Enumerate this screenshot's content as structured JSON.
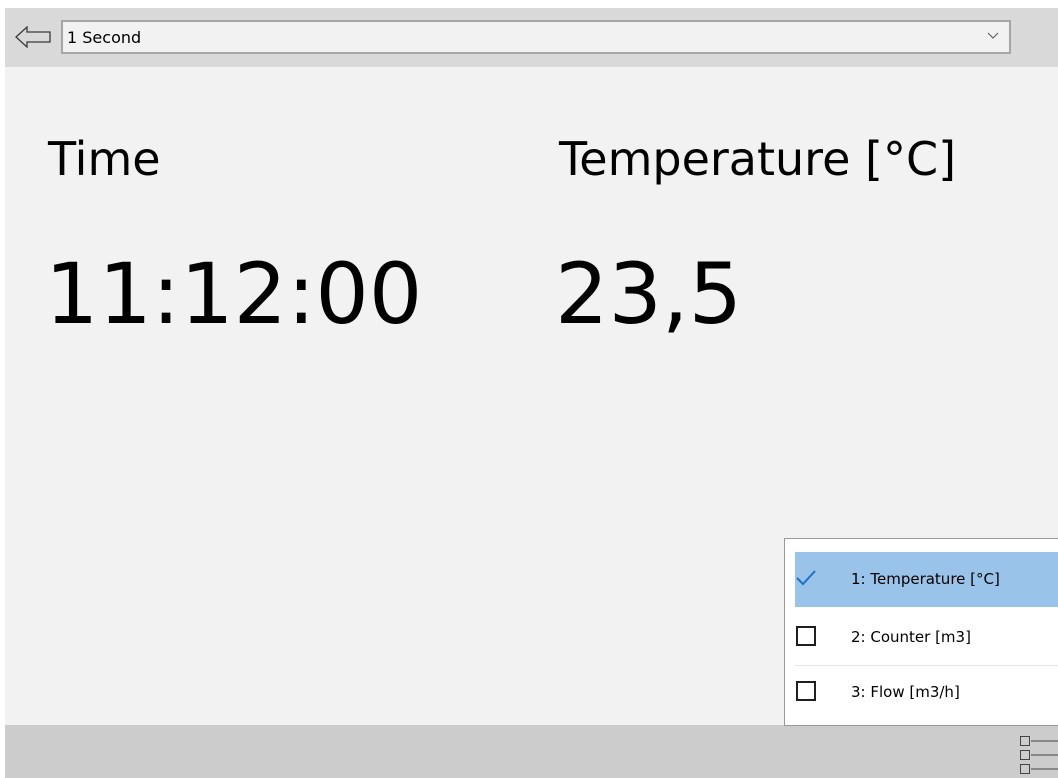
{
  "toolbar": {
    "interval_selected": "1 Second"
  },
  "readings": {
    "time_label": "Time",
    "time_value": "11:12:00",
    "temperature_label": "Temperature [°C]",
    "temperature_value": "23,5"
  },
  "channels": [
    {
      "label": "1: Temperature [°C]",
      "checked": true
    },
    {
      "label": "2: Counter [m3]",
      "checked": false
    },
    {
      "label": "3: Flow [m3/h]",
      "checked": false
    }
  ],
  "colors": {
    "selected_row": "#99c3e8",
    "check_accent": "#1a73c8"
  },
  "icons": {
    "back": "arrow-left-outline-icon",
    "dropdown": "chevron-down-icon",
    "channel_list": "list-icon"
  }
}
